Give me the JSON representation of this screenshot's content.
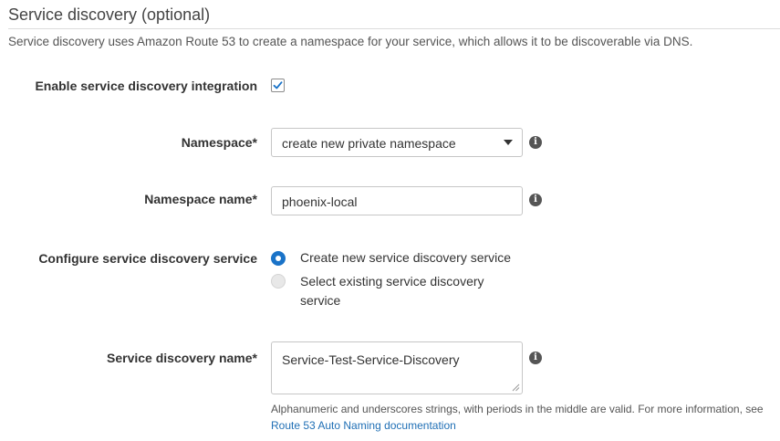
{
  "section": {
    "title": "Service discovery (optional)",
    "description": "Service discovery uses Amazon Route 53 to create a namespace for your service, which allows it to be discoverable via DNS."
  },
  "enable": {
    "label": "Enable service discovery integration",
    "checked": true
  },
  "namespace": {
    "label": "Namespace*",
    "selected": "create new private namespace"
  },
  "namespace_name": {
    "label": "Namespace name*",
    "value": "phoenix-local"
  },
  "configure": {
    "label": "Configure service discovery service",
    "options": [
      {
        "label": "Create new service discovery service",
        "selected": true
      },
      {
        "label_line1": "Select existing service discovery",
        "label_line2": "service",
        "selected": false
      }
    ]
  },
  "discovery_name": {
    "label": "Service discovery name*",
    "value": "Service-Test-Service-Discovery"
  },
  "help": {
    "text": "Alphanumeric and underscores strings, with periods in the middle are valid. For more information, see",
    "link": "Route 53 Auto Naming documentation"
  },
  "icons": {
    "info": "info-icon",
    "info_glyph": "i",
    "checkmark": "checkmark-icon",
    "caret": "caret-down-icon"
  },
  "colors": {
    "accent": "#1a73c8",
    "link": "#1f6fb5"
  }
}
